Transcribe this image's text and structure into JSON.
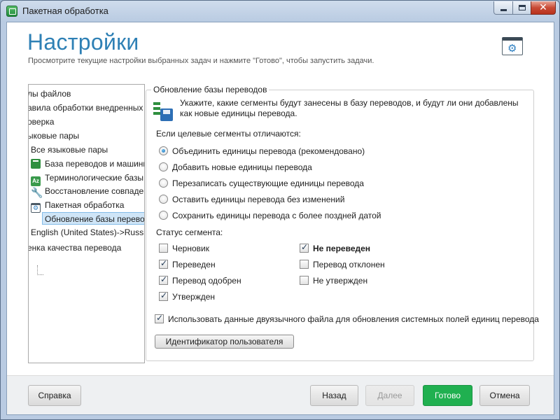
{
  "window": {
    "title": "Пакетная обработка"
  },
  "header": {
    "title": "Настройки",
    "subtitle": "Просмотрите текущие настройки выбранных задач и нажмите \"Готово\", чтобы запустить задачи."
  },
  "tree": {
    "items": [
      {
        "label": "лы файлов"
      },
      {
        "label": "авила обработки внедренных"
      },
      {
        "label": "оверка"
      },
      {
        "label": "ыковые пары"
      },
      {
        "label": "Все языковые пары"
      },
      {
        "label": "База переводов и машинн",
        "icon": "translation-memory-icon"
      },
      {
        "label": "Терминологические базы",
        "icon": "termbase-icon"
      },
      {
        "label": "Восстановление совпаден",
        "icon": "wrench-icon"
      },
      {
        "label": "Пакетная обработка",
        "icon": "batch-settings-icon"
      },
      {
        "label": "Обновление базы перево",
        "selected": true
      },
      {
        "label": "English (United States)->Russia"
      },
      {
        "label": "енка качества перевода"
      }
    ]
  },
  "group": {
    "title": "Обновление базы переводов",
    "info": "Укажите, какие сегменты будут занесены в базу переводов, и будут ли они добавлены как новые единицы перевода.",
    "differ_label": "Если целевые сегменты отличаются:",
    "options": [
      {
        "label": "Объединить единицы перевода (рекомендовано)",
        "checked": true
      },
      {
        "label": "Добавить новые единицы перевода",
        "checked": false
      },
      {
        "label": "Перезаписать существующие единицы перевода",
        "checked": false
      },
      {
        "label": "Оставить единицы перевода без изменений",
        "checked": false
      },
      {
        "label": "Сохранить единицы перевода с более поздней датой",
        "checked": false
      }
    ],
    "status_label": "Статус сегмента:",
    "statuses": [
      {
        "label": "Черновик",
        "checked": false
      },
      {
        "label": "Переведен",
        "checked": true
      },
      {
        "label": "Перевод одобрен",
        "checked": true
      },
      {
        "label": "Утвержден",
        "checked": true
      },
      {
        "label": "Не переведен",
        "checked": true
      },
      {
        "label": "Перевод отклонен",
        "checked": false
      },
      {
        "label": "Не утвержден",
        "checked": false
      }
    ],
    "bilingual_label": "Использовать данные двуязычного файла для обновления системных полей единиц перевода",
    "bilingual_checked": true,
    "user_id_button": "Идентификатор пользователя"
  },
  "footer": {
    "help": "Справка",
    "back": "Назад",
    "next": "Далее",
    "finish": "Готово",
    "cancel": "Отмена"
  },
  "colors": {
    "title": "#2e80b5",
    "primary": "#20b050",
    "selection": "#cfe5f7"
  }
}
